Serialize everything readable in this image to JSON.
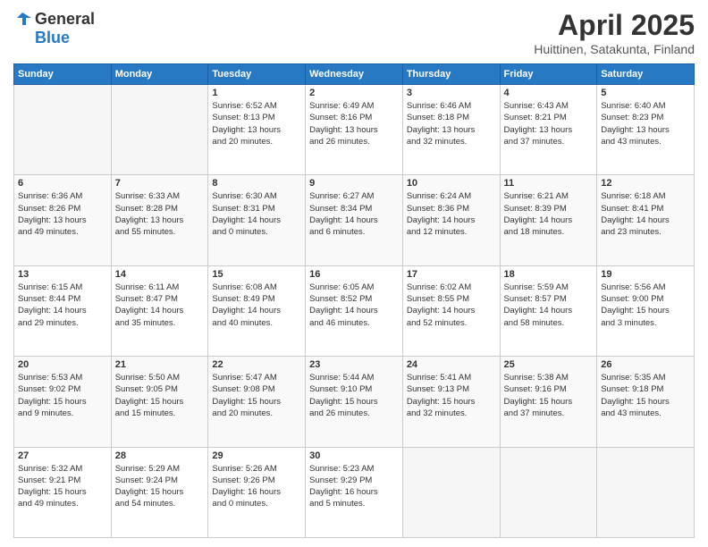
{
  "header": {
    "logo_line1": "General",
    "logo_line2": "Blue",
    "month_year": "April 2025",
    "location": "Huittinen, Satakunta, Finland"
  },
  "weekdays": [
    "Sunday",
    "Monday",
    "Tuesday",
    "Wednesday",
    "Thursday",
    "Friday",
    "Saturday"
  ],
  "weeks": [
    [
      {
        "day": "",
        "info": ""
      },
      {
        "day": "",
        "info": ""
      },
      {
        "day": "1",
        "info": "Sunrise: 6:52 AM\nSunset: 8:13 PM\nDaylight: 13 hours\nand 20 minutes."
      },
      {
        "day": "2",
        "info": "Sunrise: 6:49 AM\nSunset: 8:16 PM\nDaylight: 13 hours\nand 26 minutes."
      },
      {
        "day": "3",
        "info": "Sunrise: 6:46 AM\nSunset: 8:18 PM\nDaylight: 13 hours\nand 32 minutes."
      },
      {
        "day": "4",
        "info": "Sunrise: 6:43 AM\nSunset: 8:21 PM\nDaylight: 13 hours\nand 37 minutes."
      },
      {
        "day": "5",
        "info": "Sunrise: 6:40 AM\nSunset: 8:23 PM\nDaylight: 13 hours\nand 43 minutes."
      }
    ],
    [
      {
        "day": "6",
        "info": "Sunrise: 6:36 AM\nSunset: 8:26 PM\nDaylight: 13 hours\nand 49 minutes."
      },
      {
        "day": "7",
        "info": "Sunrise: 6:33 AM\nSunset: 8:28 PM\nDaylight: 13 hours\nand 55 minutes."
      },
      {
        "day": "8",
        "info": "Sunrise: 6:30 AM\nSunset: 8:31 PM\nDaylight: 14 hours\nand 0 minutes."
      },
      {
        "day": "9",
        "info": "Sunrise: 6:27 AM\nSunset: 8:34 PM\nDaylight: 14 hours\nand 6 minutes."
      },
      {
        "day": "10",
        "info": "Sunrise: 6:24 AM\nSunset: 8:36 PM\nDaylight: 14 hours\nand 12 minutes."
      },
      {
        "day": "11",
        "info": "Sunrise: 6:21 AM\nSunset: 8:39 PM\nDaylight: 14 hours\nand 18 minutes."
      },
      {
        "day": "12",
        "info": "Sunrise: 6:18 AM\nSunset: 8:41 PM\nDaylight: 14 hours\nand 23 minutes."
      }
    ],
    [
      {
        "day": "13",
        "info": "Sunrise: 6:15 AM\nSunset: 8:44 PM\nDaylight: 14 hours\nand 29 minutes."
      },
      {
        "day": "14",
        "info": "Sunrise: 6:11 AM\nSunset: 8:47 PM\nDaylight: 14 hours\nand 35 minutes."
      },
      {
        "day": "15",
        "info": "Sunrise: 6:08 AM\nSunset: 8:49 PM\nDaylight: 14 hours\nand 40 minutes."
      },
      {
        "day": "16",
        "info": "Sunrise: 6:05 AM\nSunset: 8:52 PM\nDaylight: 14 hours\nand 46 minutes."
      },
      {
        "day": "17",
        "info": "Sunrise: 6:02 AM\nSunset: 8:55 PM\nDaylight: 14 hours\nand 52 minutes."
      },
      {
        "day": "18",
        "info": "Sunrise: 5:59 AM\nSunset: 8:57 PM\nDaylight: 14 hours\nand 58 minutes."
      },
      {
        "day": "19",
        "info": "Sunrise: 5:56 AM\nSunset: 9:00 PM\nDaylight: 15 hours\nand 3 minutes."
      }
    ],
    [
      {
        "day": "20",
        "info": "Sunrise: 5:53 AM\nSunset: 9:02 PM\nDaylight: 15 hours\nand 9 minutes."
      },
      {
        "day": "21",
        "info": "Sunrise: 5:50 AM\nSunset: 9:05 PM\nDaylight: 15 hours\nand 15 minutes."
      },
      {
        "day": "22",
        "info": "Sunrise: 5:47 AM\nSunset: 9:08 PM\nDaylight: 15 hours\nand 20 minutes."
      },
      {
        "day": "23",
        "info": "Sunrise: 5:44 AM\nSunset: 9:10 PM\nDaylight: 15 hours\nand 26 minutes."
      },
      {
        "day": "24",
        "info": "Sunrise: 5:41 AM\nSunset: 9:13 PM\nDaylight: 15 hours\nand 32 minutes."
      },
      {
        "day": "25",
        "info": "Sunrise: 5:38 AM\nSunset: 9:16 PM\nDaylight: 15 hours\nand 37 minutes."
      },
      {
        "day": "26",
        "info": "Sunrise: 5:35 AM\nSunset: 9:18 PM\nDaylight: 15 hours\nand 43 minutes."
      }
    ],
    [
      {
        "day": "27",
        "info": "Sunrise: 5:32 AM\nSunset: 9:21 PM\nDaylight: 15 hours\nand 49 minutes."
      },
      {
        "day": "28",
        "info": "Sunrise: 5:29 AM\nSunset: 9:24 PM\nDaylight: 15 hours\nand 54 minutes."
      },
      {
        "day": "29",
        "info": "Sunrise: 5:26 AM\nSunset: 9:26 PM\nDaylight: 16 hours\nand 0 minutes."
      },
      {
        "day": "30",
        "info": "Sunrise: 5:23 AM\nSunset: 9:29 PM\nDaylight: 16 hours\nand 5 minutes."
      },
      {
        "day": "",
        "info": ""
      },
      {
        "day": "",
        "info": ""
      },
      {
        "day": "",
        "info": ""
      }
    ]
  ]
}
